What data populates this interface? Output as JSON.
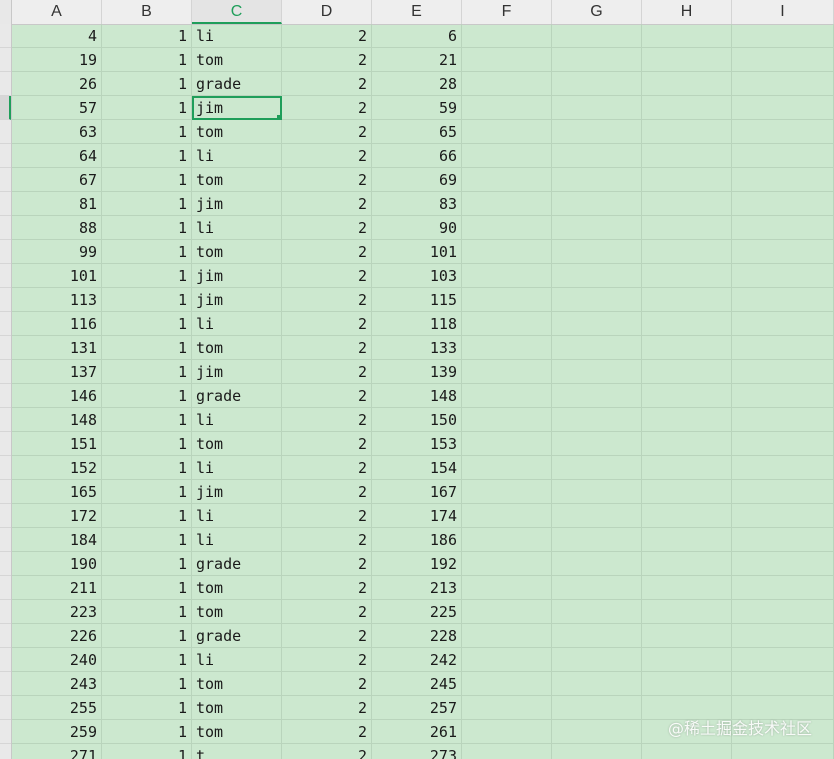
{
  "columns": [
    "A",
    "B",
    "C",
    "D",
    "E",
    "F",
    "G",
    "H",
    "I"
  ],
  "active_column": "C",
  "selected_cell": {
    "row_index": 3,
    "column": "C"
  },
  "rows": [
    [
      "4",
      "1",
      "li",
      "2",
      "6"
    ],
    [
      "19",
      "1",
      "tom",
      "2",
      "21"
    ],
    [
      "26",
      "1",
      "grade",
      "2",
      "28"
    ],
    [
      "57",
      "1",
      "jim",
      "2",
      "59"
    ],
    [
      "63",
      "1",
      "tom",
      "2",
      "65"
    ],
    [
      "64",
      "1",
      "li",
      "2",
      "66"
    ],
    [
      "67",
      "1",
      "tom",
      "2",
      "69"
    ],
    [
      "81",
      "1",
      "jim",
      "2",
      "83"
    ],
    [
      "88",
      "1",
      "li",
      "2",
      "90"
    ],
    [
      "99",
      "1",
      "tom",
      "2",
      "101"
    ],
    [
      "101",
      "1",
      "jim",
      "2",
      "103"
    ],
    [
      "113",
      "1",
      "jim",
      "2",
      "115"
    ],
    [
      "116",
      "1",
      "li",
      "2",
      "118"
    ],
    [
      "131",
      "1",
      "tom",
      "2",
      "133"
    ],
    [
      "137",
      "1",
      "jim",
      "2",
      "139"
    ],
    [
      "146",
      "1",
      "grade",
      "2",
      "148"
    ],
    [
      "148",
      "1",
      "li",
      "2",
      "150"
    ],
    [
      "151",
      "1",
      "tom",
      "2",
      "153"
    ],
    [
      "152",
      "1",
      "li",
      "2",
      "154"
    ],
    [
      "165",
      "1",
      "jim",
      "2",
      "167"
    ],
    [
      "172",
      "1",
      "li",
      "2",
      "174"
    ],
    [
      "184",
      "1",
      "li",
      "2",
      "186"
    ],
    [
      "190",
      "1",
      "grade",
      "2",
      "192"
    ],
    [
      "211",
      "1",
      "tom",
      "2",
      "213"
    ],
    [
      "223",
      "1",
      "tom",
      "2",
      "225"
    ],
    [
      "226",
      "1",
      "grade",
      "2",
      "228"
    ],
    [
      "240",
      "1",
      "li",
      "2",
      "242"
    ],
    [
      "243",
      "1",
      "tom",
      "2",
      "245"
    ],
    [
      "255",
      "1",
      "tom",
      "2",
      "257"
    ],
    [
      "259",
      "1",
      "tom",
      "2",
      "261"
    ],
    [
      "271",
      "1",
      "t",
      "2",
      "273"
    ]
  ],
  "watermark": "@稀土掘金技术社区",
  "colors": {
    "sheet_bg": "#cce8cf",
    "selection": "#1f9e5a",
    "header_bg": "#eeeeee"
  }
}
